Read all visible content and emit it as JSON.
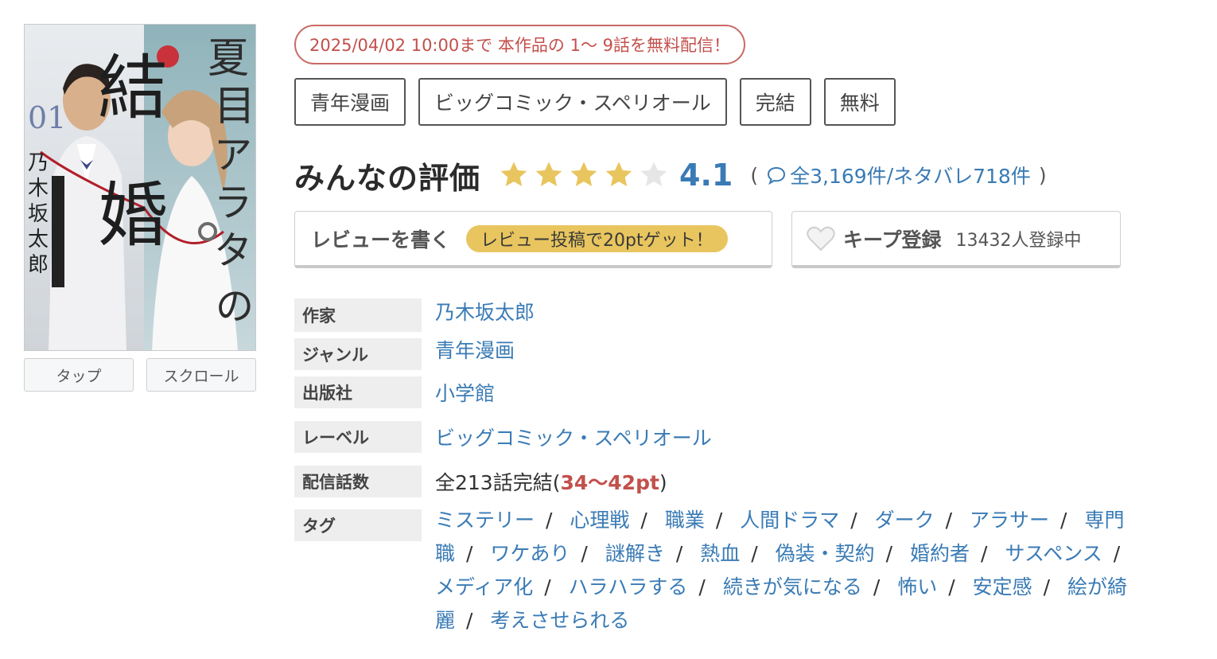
{
  "cover": {
    "alt": "夏目アラタの結婚 01 乃木坂太郎",
    "title_big": "結婚",
    "title_side": "夏目アラタの",
    "volume": "01",
    "author_vertical": "乃木坂太郎",
    "band_text": "夏目アラタの結婚"
  },
  "view_buttons": {
    "tap": "タップ",
    "scroll": "スクロール"
  },
  "campaign": "2025/04/02 10:00まで 本作品の 1〜 9話を無料配信！",
  "chips": [
    "青年漫画",
    "ビッグコミック・スペリオール",
    "完結",
    "無料"
  ],
  "rating": {
    "title": "みんなの評価",
    "score": "4.1",
    "stars_filled": 4,
    "stars_total": 5,
    "open_paren": "(",
    "close_paren": ")",
    "reviews": "全3,169件",
    "slash": "/",
    "spoilers": "ネタバレ718件"
  },
  "review_button": {
    "label": "レビューを書く",
    "pill": "レビュー投稿で20ptゲット！"
  },
  "keep_button": {
    "label": "キープ登録",
    "count": "13432人登録中"
  },
  "details": {
    "author": {
      "key": "作家",
      "value": "乃木坂太郎"
    },
    "genre": {
      "key": "ジャンル",
      "value": "青年漫画"
    },
    "publisher": {
      "key": "出版社",
      "value": "小学館"
    },
    "label": {
      "key": "レーベル",
      "value": "ビッグコミック・スペリオール"
    },
    "episodes": {
      "key": "配信話数",
      "value": "全213話完結(",
      "points": "34〜42pt",
      "close": ")"
    },
    "tags": {
      "key": "タグ",
      "items": [
        "ミステリー",
        "心理戦",
        "職業",
        "人間ドラマ",
        "ダーク",
        "アラサー",
        "専門職",
        "ワケあり",
        "謎解き",
        "熱血",
        "偽装・契約",
        "婚約者",
        "サスペンス",
        "メディア化",
        "ハラハラする",
        "続きが気になる",
        "怖い",
        "安定感",
        "絵が綺麗",
        "考えさせられる"
      ]
    }
  },
  "colors": {
    "link": "#3a7bb5",
    "accent_red": "#c2504c",
    "star": "#e8c55e",
    "star_empty": "#e6e6e6",
    "pill": "#e8c55e"
  }
}
